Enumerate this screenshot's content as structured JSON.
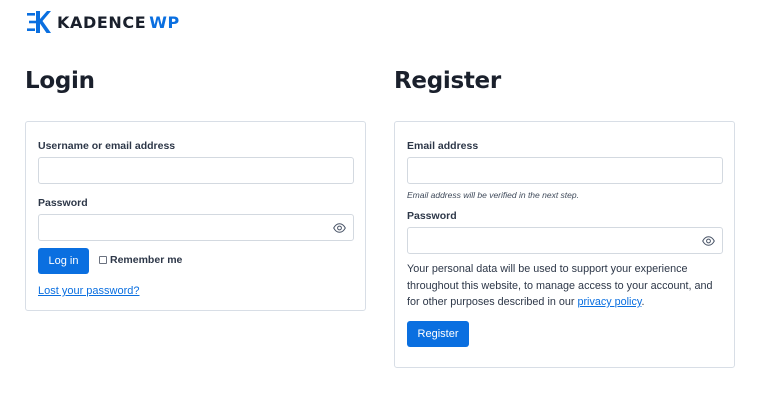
{
  "brand": {
    "name": "KADENCE",
    "suffix": "WP",
    "color": "#0a6fe0",
    "icon": "kadence-logo-icon"
  },
  "login": {
    "title": "Login",
    "username_label": "Username or email address",
    "username_value": "",
    "password_label": "Password",
    "password_value": "",
    "password_toggle_icon": "eye-icon",
    "submit_label": "Log in",
    "remember_label": "Remember me",
    "remember_checked": false,
    "lost_password_label": "Lost your password?"
  },
  "register": {
    "title": "Register",
    "email_label": "Email address",
    "email_value": "",
    "email_hint": "Email address will be verified in the next step.",
    "password_label": "Password",
    "password_value": "",
    "password_toggle_icon": "eye-icon",
    "privacy_text_before": "Your personal data will be used to support your experience throughout this website, to manage access to your account, and for other purposes described in our ",
    "privacy_link_label": "privacy policy",
    "privacy_text_after": ".",
    "submit_label": "Register"
  }
}
